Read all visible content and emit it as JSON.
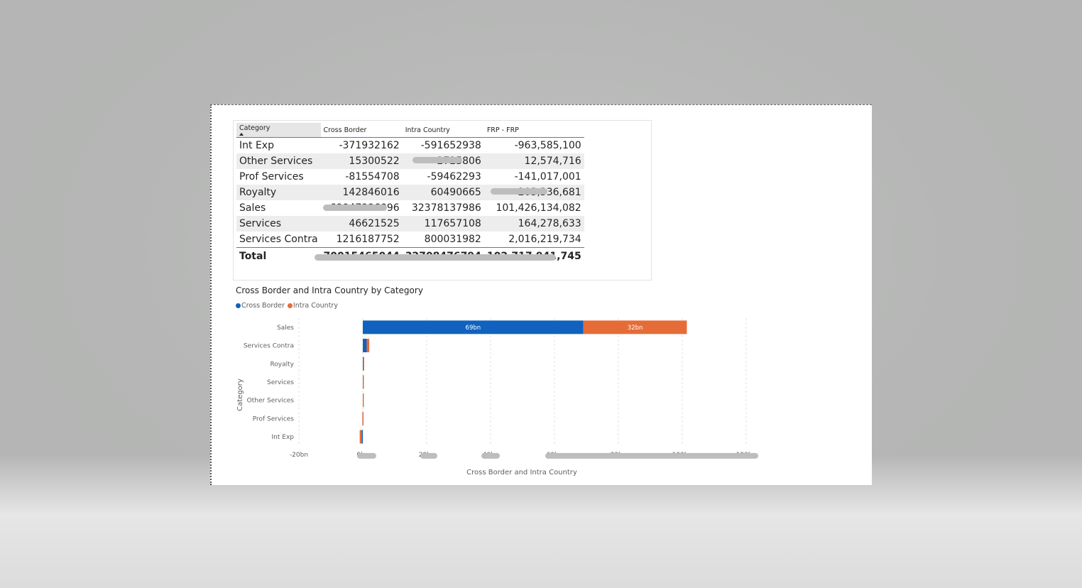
{
  "table": {
    "headers": [
      "Category",
      "Cross Border",
      "Intra Country",
      "FRP - FRP"
    ],
    "rows": [
      {
        "category": "Int Exp",
        "cross_border": "-371932162",
        "intra_country": "-591652938",
        "frp": "-963,585,100"
      },
      {
        "category": "Other Services",
        "cross_border": "15300522",
        "intra_country": "2725806",
        "frp": "12,574,716"
      },
      {
        "category": "Prof Services",
        "cross_border": "-81554708",
        "intra_country": "-59462293",
        "frp": "-141,017,001"
      },
      {
        "category": "Royalty",
        "cross_border": "142846016",
        "intra_country": "60490665",
        "frp": "203,336,681"
      },
      {
        "category": "Sales",
        "cross_border": "69047996096",
        "intra_country": "32378137986",
        "frp": "101,426,134,082"
      },
      {
        "category": "Services",
        "cross_border": "46621525",
        "intra_country": "117657108",
        "frp": "164,278,633"
      },
      {
        "category": "Services Contra",
        "cross_border": "1216187752",
        "intra_country": "800031982",
        "frp": "2,016,219,734"
      }
    ],
    "total": {
      "label": "Total",
      "cross_border": "70015465044",
      "intra_country": "32708476794",
      "frp": "102,717,941,745"
    }
  },
  "chart_data": {
    "type": "bar",
    "orientation": "horizontal",
    "stacked": true,
    "title": "Cross Border and Intra Country by Category",
    "xlabel": "Cross Border and Intra Country",
    "ylabel": "Category",
    "categories": [
      "Sales",
      "Services Contra",
      "Royalty",
      "Services",
      "Other Services",
      "Prof Services",
      "Int Exp"
    ],
    "series": [
      {
        "name": "Cross Border",
        "color": "#1062BE",
        "values": [
          69.05,
          1.216,
          0.143,
          0.047,
          0.015,
          -0.082,
          -0.372
        ]
      },
      {
        "name": "Intra Country",
        "color": "#E66C37",
        "values": [
          32.38,
          0.8,
          0.06,
          0.118,
          0.003,
          -0.059,
          -0.592
        ]
      }
    ],
    "data_labels": [
      "69bn",
      "32bn"
    ],
    "x_ticks": [
      "-20bn",
      "0bn",
      "20bn",
      "40bn",
      "60bn",
      "80bn",
      "100bn",
      "120bn"
    ],
    "xlim": [
      -20,
      120
    ],
    "grid": true,
    "legend_position": "top-left"
  }
}
